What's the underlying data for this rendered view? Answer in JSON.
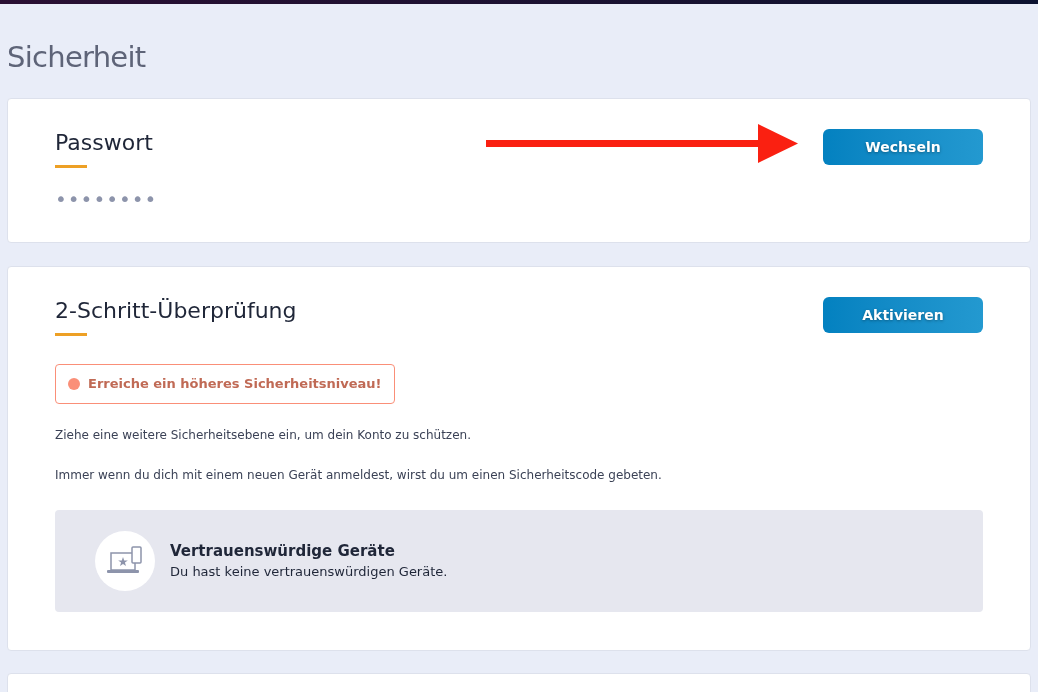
{
  "page_title": "Sicherheit",
  "password_card": {
    "title": "Passwort",
    "masked_value": "••••••••",
    "button": "Wechseln"
  },
  "two_step_card": {
    "title": "2-Schritt-Überprüfung",
    "button": "Aktivieren",
    "alert": {
      "text": "Erreiche ein höheres Sicherheitsniveau!",
      "color": "#fa8f78"
    },
    "paragraphs": [
      "Ziehe eine weitere Sicherheitsebene ein, um dein Konto zu schützen.",
      "Immer wenn du dich mit einem neuen Gerät anmeldest, wirst du um einen Sicherheitscode gebeten."
    ],
    "devices": {
      "title": "Vertrauenswürdige Geräte",
      "subtitle": "Du hast keine vertrauenswürdigen Geräte."
    }
  }
}
